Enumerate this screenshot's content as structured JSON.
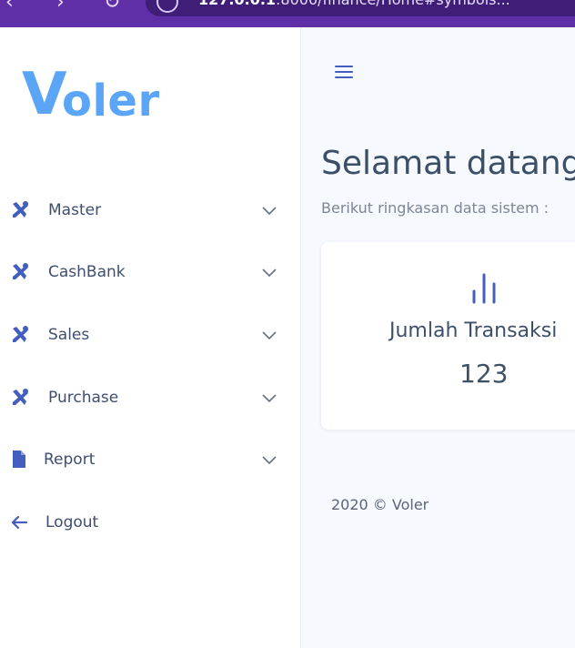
{
  "browser": {
    "url_host": "127.0.0.1",
    "url_path": ":8000/finance/Home#symbols..."
  },
  "sidebar": {
    "logo": "Voler",
    "items": [
      {
        "label": "Master",
        "icon": "tools-icon"
      },
      {
        "label": "CashBank",
        "icon": "tools-icon"
      },
      {
        "label": "Sales",
        "icon": "tools-icon"
      },
      {
        "label": "Purchase",
        "icon": "tools-icon"
      },
      {
        "label": "Report",
        "icon": "file-icon"
      },
      {
        "label": "Logout",
        "icon": "arrow-left-icon"
      }
    ]
  },
  "main": {
    "title": "Selamat datang",
    "subtitle": "Berikut ringkasan data sistem :",
    "card": {
      "label": "Jumlah Transaksi",
      "value": "123",
      "icon": "bar-chart-icon"
    },
    "footer": "2020 © Voler"
  },
  "colors": {
    "accent": "#435ebe",
    "logo": "#5aa5f5",
    "browser_bar": "#5f2fa8",
    "background": "#f6f9fd"
  }
}
